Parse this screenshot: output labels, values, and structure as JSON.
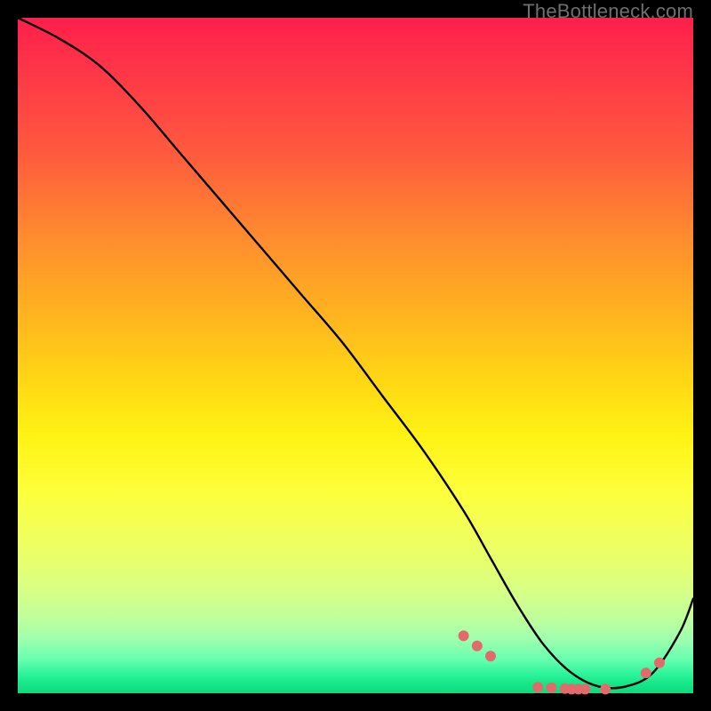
{
  "watermark": "TheBottleneck.com",
  "chart_data": {
    "type": "line",
    "title": "",
    "xlabel": "",
    "ylabel": "",
    "xlim": [
      0,
      100
    ],
    "ylim": [
      0,
      100
    ],
    "x": [
      0,
      6,
      12,
      18,
      24,
      30,
      36,
      42,
      48,
      54,
      60,
      66,
      70,
      74,
      78,
      82,
      86,
      90,
      94,
      98,
      100
    ],
    "values": [
      100,
      97,
      93,
      87,
      80,
      73,
      66,
      59,
      52,
      44,
      36,
      27,
      20,
      13,
      7,
      3,
      1,
      1,
      3,
      9,
      14
    ],
    "markers_x": [
      66,
      68,
      70,
      77,
      79,
      81,
      82,
      83,
      84,
      87,
      93,
      95
    ],
    "markers_y": [
      8.5,
      7.0,
      5.5,
      0.9,
      0.8,
      0.7,
      0.6,
      0.6,
      0.6,
      0.6,
      3.0,
      4.5
    ],
    "gradient_stops": [
      {
        "pos": 0.0,
        "color": "#ff1f4b"
      },
      {
        "pos": 0.32,
        "color": "#ff8a2f"
      },
      {
        "pos": 0.62,
        "color": "#fff314"
      },
      {
        "pos": 0.85,
        "color": "#d6ff86"
      },
      {
        "pos": 1.0,
        "color": "#0fd97c"
      }
    ],
    "marker_color": "#e26a6a",
    "line_color": "#000000"
  }
}
